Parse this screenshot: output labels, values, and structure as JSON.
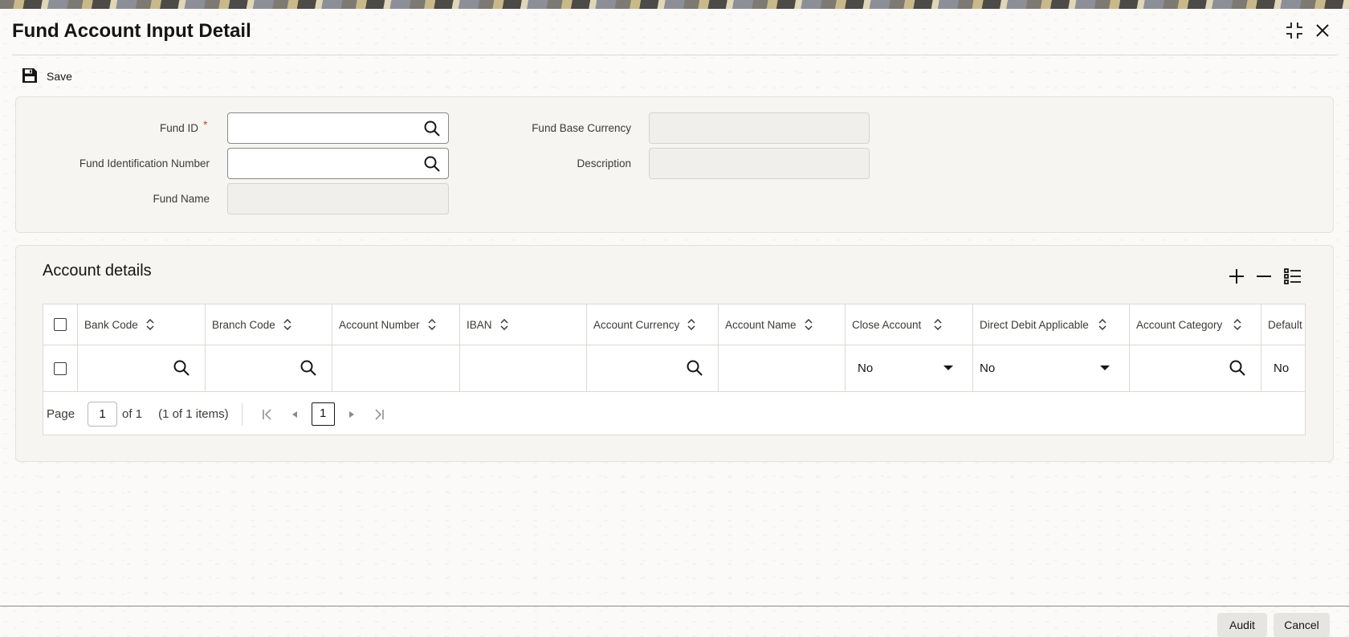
{
  "window": {
    "title": "Fund Account Input Detail",
    "maximize_icon": "maximize-icon",
    "close_icon": "close-icon"
  },
  "toolbar": {
    "save_label": "Save",
    "save_icon": "floppy-disk-icon"
  },
  "fund_form": {
    "fund_id_label": "Fund ID",
    "fund_id_required": "*",
    "fund_id_value": "",
    "fund_identification_number_label": "Fund Identification Number",
    "fund_identification_number_value": "",
    "fund_name_label": "Fund Name",
    "fund_name_value": "",
    "fund_base_currency_label": "Fund Base Currency",
    "fund_base_currency_value": "",
    "description_label": "Description",
    "description_value": ""
  },
  "account_details": {
    "title": "Account details",
    "toolbar_icons": [
      "add-icon",
      "remove-icon",
      "list-view-icon"
    ],
    "columns": [
      "Bank Code",
      "Branch Code",
      "Account Number",
      "IBAN",
      "Account Currency",
      "Account Name",
      "Close Account",
      "Direct Debit Applicable",
      "Account Category",
      "Default"
    ],
    "rows": [
      {
        "bank_code": "",
        "branch_code": "",
        "account_number": "",
        "iban": "",
        "account_currency": "",
        "account_name": "",
        "close_account": "No",
        "direct_debit_applicable": "No",
        "account_category": "",
        "default": "No"
      }
    ],
    "pager": {
      "page_label": "Page",
      "page_value": "1",
      "of_label": "of 1",
      "items_label": "(1 of 1 items)",
      "current_page": "1"
    }
  },
  "footer": {
    "audit_label": "Audit",
    "cancel_label": "Cancel"
  },
  "colors": {
    "required": "#c74634",
    "text": "#161513",
    "border": "#dcd9d4",
    "button_bg": "#e7e5e1"
  }
}
